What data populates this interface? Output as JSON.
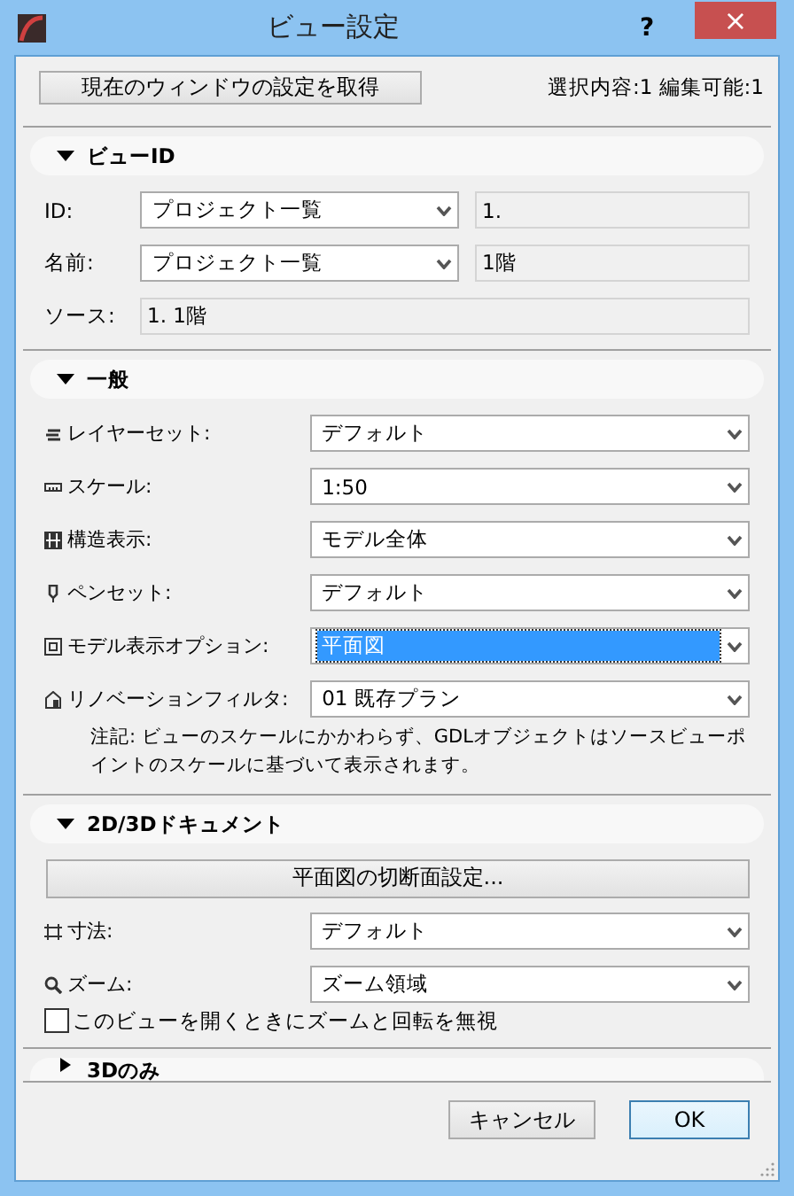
{
  "window": {
    "title": "ビュー設定",
    "help": "?",
    "close": "×"
  },
  "top": {
    "button": "現在のウィンドウの設定を取得",
    "status": "選択内容:1 編集可能:1"
  },
  "sections": [
    {
      "title": "ビューID",
      "expanded": true,
      "rows": [
        {
          "kind": "select-field",
          "label": "ID:",
          "value": "プロジェクト一覧",
          "field": "1."
        },
        {
          "kind": "select-field",
          "label": "名前:",
          "value": "プロジェクト一覧",
          "field": "1階"
        },
        {
          "kind": "field",
          "label": "ソース:",
          "value": "1. 1階"
        }
      ]
    },
    {
      "title": "一般",
      "expanded": true,
      "rows": [
        {
          "kind": "select",
          "label": "レイヤーセット:",
          "value": "デフォルト",
          "focused": false
        },
        {
          "kind": "select",
          "label": "スケール:",
          "value": "1:50",
          "focused": false
        },
        {
          "kind": "select",
          "label": "構造表示:",
          "value": "モデル全体",
          "focused": false
        },
        {
          "kind": "select",
          "label": "ペンセット:",
          "value": "デフォルト",
          "focused": false
        },
        {
          "kind": "select",
          "label": "モデル表示オプション:",
          "value": "平面図",
          "focused": true
        },
        {
          "kind": "select",
          "label": "リノベーションフィルタ:",
          "value": "01 既存プラン",
          "focused": false
        },
        {
          "kind": "note",
          "text": "注記: ビューのスケールにかかわらず、GDLオブジェクトはソースビューポイントのスケールに基づいて表示されます。"
        }
      ]
    },
    {
      "title": "2D/3Dドキュメント",
      "expanded": true,
      "rows": [
        {
          "kind": "button",
          "label": "平面図の切断面設定..."
        },
        {
          "kind": "select",
          "label": "寸法:",
          "value": "デフォルト",
          "focused": false
        },
        {
          "kind": "select",
          "label": "ズーム:",
          "value": "ズーム領域",
          "focused": false
        },
        {
          "kind": "checkbox",
          "label": "このビューを開くときにズームと回転を無視",
          "checked": false
        }
      ]
    },
    {
      "title": "3Dのみ",
      "expanded": false
    }
  ],
  "buttons": [
    {
      "label": "キャンセル",
      "default": false
    },
    {
      "label": "OK",
      "default": true
    }
  ]
}
